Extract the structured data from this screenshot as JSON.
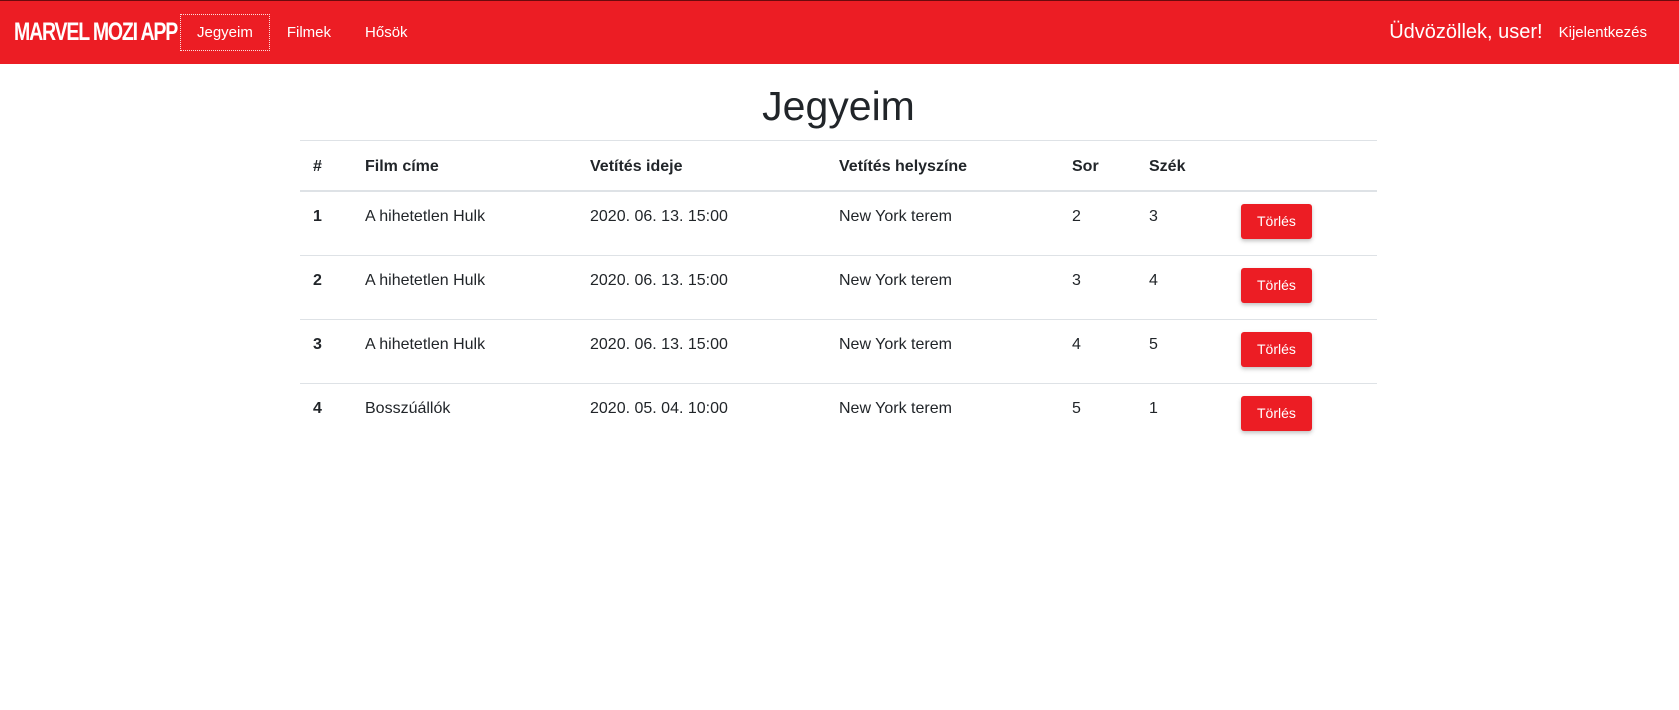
{
  "navbar": {
    "brand": "MARVEL MOZI APP",
    "links": [
      {
        "label": "Jegyeim",
        "active": true
      },
      {
        "label": "Filmek",
        "active": false
      },
      {
        "label": "Hősök",
        "active": false
      }
    ],
    "welcome": "Üdvözöllek, user!",
    "logout": "Kijelentkezés",
    "accent_color": "#ec1d24"
  },
  "main": {
    "title": "Jegyeim",
    "table": {
      "headers": [
        "#",
        "Film címe",
        "Vetítés ideje",
        "Vetítés helyszíne",
        "Sor",
        "Szék",
        ""
      ],
      "rows": [
        {
          "num": "1",
          "film": "A hihetetlen Hulk",
          "time": "2020. 06. 13. 15:00",
          "place": "New York terem",
          "row": "2",
          "seat": "3",
          "action": "Törlés"
        },
        {
          "num": "2",
          "film": "A hihetetlen Hulk",
          "time": "2020. 06. 13. 15:00",
          "place": "New York terem",
          "row": "3",
          "seat": "4",
          "action": "Törlés"
        },
        {
          "num": "3",
          "film": "A hihetetlen Hulk",
          "time": "2020. 06. 13. 15:00",
          "place": "New York terem",
          "row": "4",
          "seat": "5",
          "action": "Törlés"
        },
        {
          "num": "4",
          "film": "Bosszúállók",
          "time": "2020. 05. 04. 10:00",
          "place": "New York terem",
          "row": "5",
          "seat": "1",
          "action": "Törlés"
        }
      ]
    }
  }
}
